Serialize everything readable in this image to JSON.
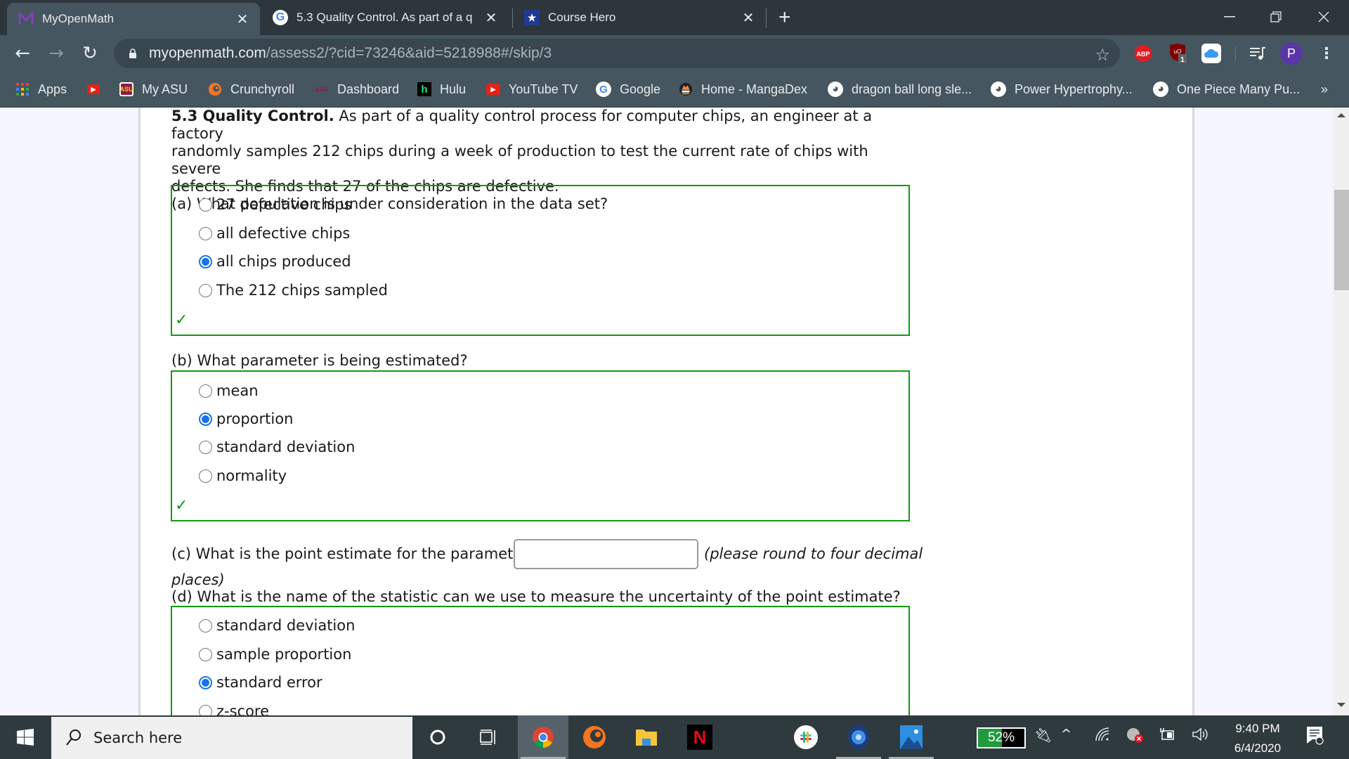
{
  "browser": {
    "tabs": [
      {
        "title": "MyOpenMath",
        "icon": "myopenmath-icon",
        "active": true
      },
      {
        "title": "5.3 Quality Control. As part of a q",
        "icon": "google-icon",
        "active": false
      },
      {
        "title": "Course Hero",
        "icon": "coursehero-icon",
        "active": false
      }
    ],
    "url_domain": "myopenmath.com",
    "url_path": "/assess2/?cid=73246&aid=5218988#/skip/3",
    "extensions": {
      "abp_label": "ABP",
      "ublock_label": "uO",
      "ublock_badge": "1",
      "profile_initial": "P"
    },
    "bookmarks": [
      {
        "label": "Apps",
        "icon": "apps-grid-icon"
      },
      {
        "label": "",
        "icon": "youtube-icon"
      },
      {
        "label": "My ASU",
        "icon": "asu-icon"
      },
      {
        "label": "Crunchyroll",
        "icon": "crunchyroll-icon"
      },
      {
        "label": "Dashboard",
        "icon": "asu-icon"
      },
      {
        "label": "Hulu",
        "icon": "hulu-icon"
      },
      {
        "label": "YouTube TV",
        "icon": "youtube-tv-icon"
      },
      {
        "label": "Google",
        "icon": "google-icon"
      },
      {
        "label": "Home - MangaDex",
        "icon": "mangadex-icon"
      },
      {
        "label": "dragon ball long sle...",
        "icon": "globe-icon"
      },
      {
        "label": "Power Hypertrophy...",
        "icon": "globe-icon"
      },
      {
        "label": "One Piece Many Pu...",
        "icon": "globe-icon"
      }
    ],
    "bookmarks_overflow": "»"
  },
  "question": {
    "title_bold": "5.3 Quality Control.",
    "intro_line1": " As part of a quality control process for computer chips, an engineer at a factory",
    "intro_line2": "randomly samples 212 chips during a week of production to test the current rate of chips with severe",
    "intro_line3": "defects. She finds that 27 of the chips are defective.",
    "part_a": {
      "prompt": "(a) What population is under consideration in the data set?",
      "options": [
        "27 defective chips",
        "all defective chips",
        "all chips produced",
        "The 212 chips sampled"
      ],
      "selected_index": 2,
      "status": "correct"
    },
    "part_b": {
      "prompt": "(b) What parameter is being estimated?",
      "options": [
        "mean",
        "proportion",
        "standard deviation",
        "normality"
      ],
      "selected_index": 1,
      "status": "correct"
    },
    "part_c": {
      "prompt": "(c) What is the point estimate for the parameter?",
      "value": "",
      "hint_line1": "(please round to four decimal",
      "hint_line2": "places)"
    },
    "part_d": {
      "prompt": "(d) What is the name of the statistic can we use to measure the uncertainty of the point estimate?",
      "options": [
        "standard deviation",
        "sample proportion",
        "standard error",
        "z-score"
      ],
      "selected_index": 2
    }
  },
  "taskbar": {
    "search_placeholder": "Search here",
    "battery_percent": 52,
    "battery_label": "52%",
    "time": "9:40 PM",
    "date": "6/4/2020",
    "colors": {
      "accent_green": "#119a11",
      "radio_blue": "#1a73e8"
    }
  }
}
